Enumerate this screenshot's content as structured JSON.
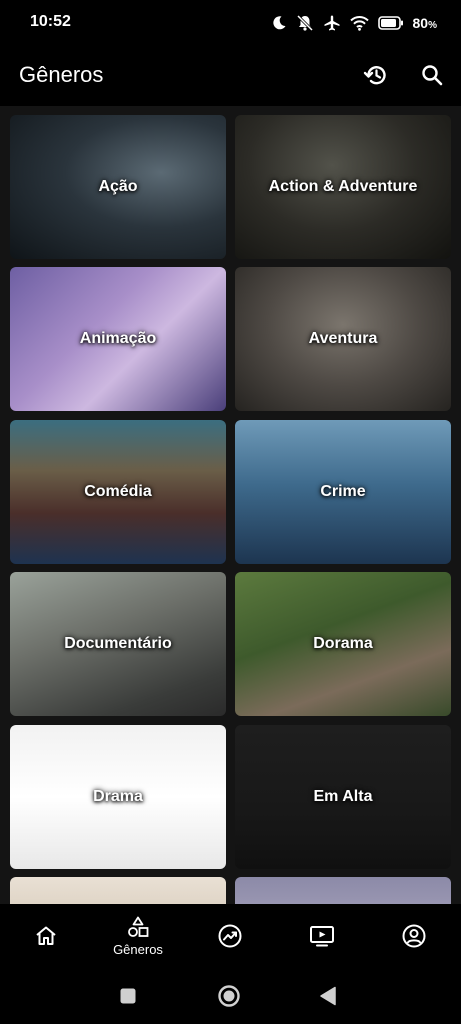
{
  "status_bar": {
    "time": "10:52",
    "battery": "80"
  },
  "app_bar": {
    "title": "Gêneros"
  },
  "genres": [
    {
      "label": "Ação"
    },
    {
      "label": "Action & Adventure"
    },
    {
      "label": "Animação"
    },
    {
      "label": "Aventura"
    },
    {
      "label": "Comédia"
    },
    {
      "label": "Crime"
    },
    {
      "label": "Documentário"
    },
    {
      "label": "Dorama"
    },
    {
      "label": "Drama"
    },
    {
      "label": "Em Alta"
    }
  ],
  "bottom_nav": {
    "items": [
      {
        "icon": "home-icon",
        "label": ""
      },
      {
        "icon": "shapes-icon",
        "label": "Gêneros"
      },
      {
        "icon": "trending-icon",
        "label": ""
      },
      {
        "icon": "tv-icon",
        "label": ""
      },
      {
        "icon": "profile-icon",
        "label": ""
      }
    ]
  }
}
